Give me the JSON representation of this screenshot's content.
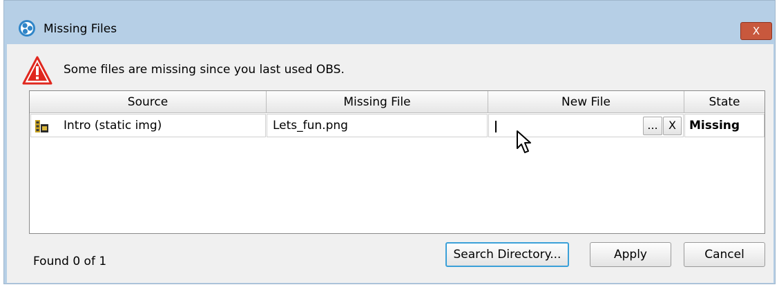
{
  "window": {
    "title": "Missing Files",
    "close_label": "X",
    "app_icon": "obs-logo-icon"
  },
  "warning": {
    "icon": "warning-triangle-icon",
    "message": "Some files are missing since you last used OBS."
  },
  "table": {
    "columns": [
      "Source",
      "Missing File",
      "New File",
      "State"
    ],
    "rows": [
      {
        "source": "Intro (static img)",
        "source_icon": "image-source-icon",
        "missing_file": "Lets_fun.png",
        "new_file": "",
        "browse_label": "...",
        "clear_label": "X",
        "state": "Missing"
      }
    ]
  },
  "footer": {
    "status": "Found 0 of 1",
    "search_button": "Search Directory...",
    "apply_button": "Apply",
    "cancel_button": "Cancel"
  },
  "colors": {
    "title_bar": "#b6cfe6",
    "close_button": "#c8583d",
    "focus_ring": "#3aa0d8",
    "warning_red": "#e0271e"
  }
}
